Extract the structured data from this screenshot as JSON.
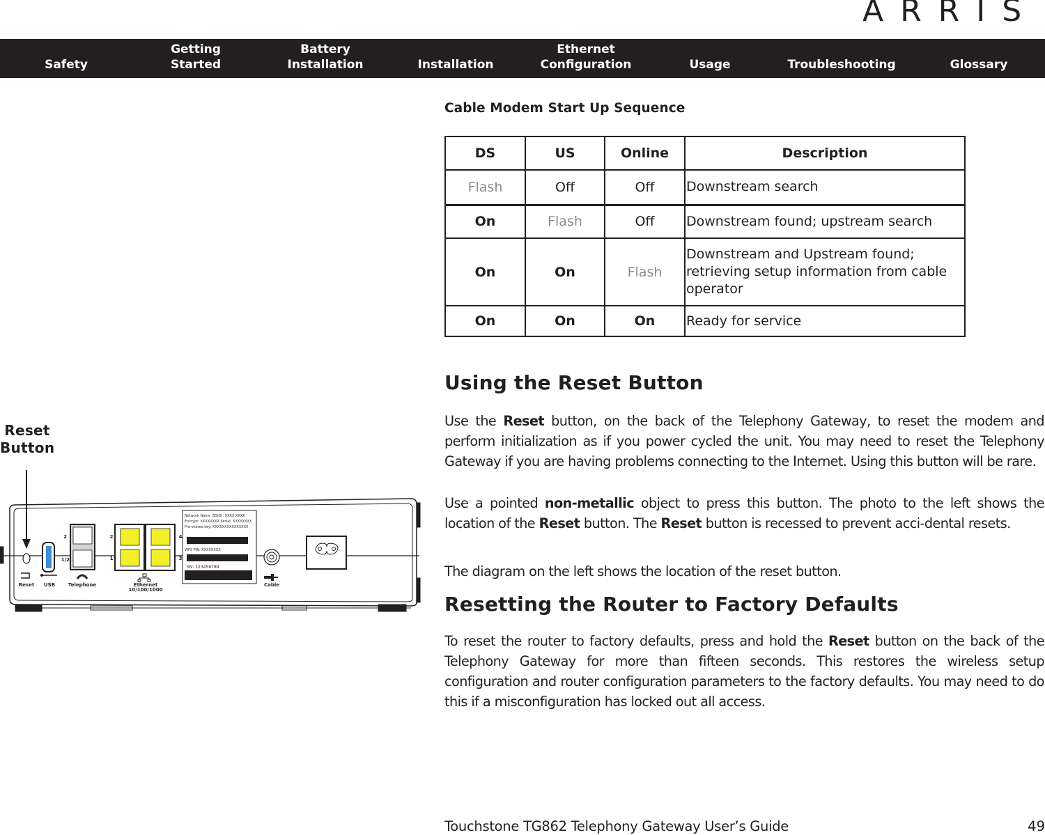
{
  "header": {
    "logo": "ARRIS",
    "nav": [
      {
        "lines": [
          "Safety"
        ]
      },
      {
        "lines": [
          "Getting",
          "Started"
        ]
      },
      {
        "lines": [
          "Battery",
          "Installation"
        ]
      },
      {
        "lines": [
          "Installation"
        ]
      },
      {
        "lines": [
          "Ethernet",
          "Configuration"
        ]
      },
      {
        "lines": [
          "Usage"
        ]
      },
      {
        "lines": [
          "Troubleshooting"
        ]
      },
      {
        "lines": [
          "Glossary"
        ]
      }
    ]
  },
  "startup_table": {
    "title": "Cable Modem Start Up Sequence",
    "columns": [
      "DS",
      "US",
      "Online",
      "Description"
    ],
    "rows": [
      {
        "ds": "Flash",
        "us": "Off",
        "online": "Off",
        "description": "Downstream search"
      },
      {
        "ds": "On",
        "us": "Flash",
        "online": "Off",
        "description": "Downstream found; upstream search"
      },
      {
        "ds": "On",
        "us": "On",
        "online": "Flash",
        "description": "Downstream and Upstream found; retrieving setup information from cable operator"
      },
      {
        "ds": "On",
        "us": "On",
        "online": "On",
        "description": "Ready for service"
      }
    ]
  },
  "reset_section": {
    "heading": "Using the Reset Button",
    "p1": {
      "before": "Use the ",
      "bold": "Reset",
      "after": " button, on the back of the Telephony Gateway, to reset the modem and perform initialization as if you power cycled the unit. You may need to reset the Telephony Gateway if you are having problems connecting to the Internet. Using this button will be rare."
    },
    "p2": {
      "a": "Use a pointed ",
      "b1": "non-metallic",
      "c": " object to press this button. The photo to the left shows the location of the ",
      "b2": "Reset",
      "d": " button. The ",
      "b3": "Reset",
      "e": " button is recessed to prevent acci-dental resets."
    },
    "p3": "The diagram on the left shows the location of the reset button."
  },
  "factory_section": {
    "heading": "Resetting the Router to Factory Defaults",
    "p1": {
      "before": "To reset the router to factory defaults, press and hold the ",
      "bold": "Reset",
      "after": " button on the back of the Telephony Gateway for more than fifteen seconds. This restores the wireless setup configuration and router configuration parameters to the factory defaults. You may need to do this if a misconfiguration has locked out all access."
    }
  },
  "diagram": {
    "callout": [
      "Reset",
      "Button"
    ],
    "port_labels": {
      "reset": "Reset",
      "usb": "USB",
      "telephone": "Telephone",
      "ethernet": "Ethernet",
      "ethernet_speed": "10/100/1000",
      "cable": "Cable"
    },
    "tel_port_numbers": [
      "2",
      "1/2"
    ],
    "eth_port_numbers": [
      "2",
      "1",
      "4",
      "3"
    ],
    "sticker_lines": [
      "Network Name (SSID): XXXX XXXX",
      "Encrypt: XXXXXXXX  Serial: XXXXXXXX",
      "Pre-shared key: XXXXXXXXXXXXXXX",
      "WPS PIN: XXXXXXXX",
      "SN: 123456789"
    ],
    "colors": {
      "ethernet_port": "#f2ef2a",
      "usb_port": "#3b8fd6",
      "phone_panel": "#d3d3d3"
    }
  },
  "footer": {
    "title": "Touchstone TG862 Telephony Gateway User’s Guide",
    "page": "49"
  }
}
